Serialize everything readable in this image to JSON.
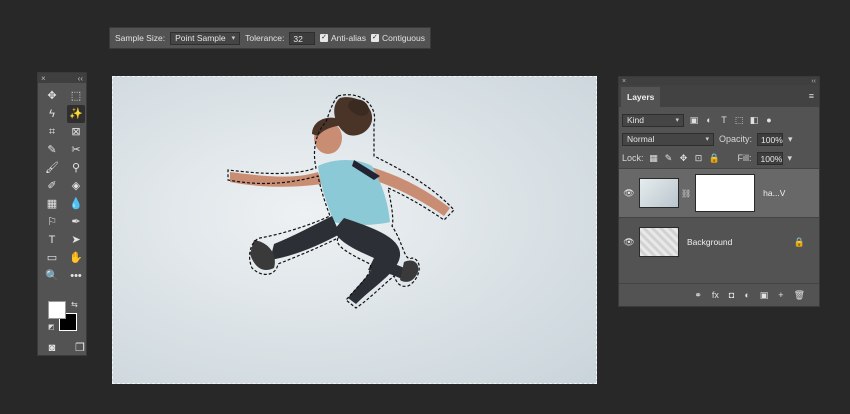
{
  "options_bar": {
    "sample_size_label": "Sample Size:",
    "sample_size_value": "Point Sample",
    "tolerance_label": "Tolerance:",
    "tolerance_value": "32",
    "anti_alias_label": "Anti-alias",
    "anti_alias_checked": true,
    "contiguous_label": "Contiguous",
    "contiguous_checked": true
  },
  "tools": {
    "header_close": "×",
    "header_collapse": "‹‹",
    "items": [
      {
        "glyph": "✥"
      },
      {
        "glyph": "⬚"
      },
      {
        "glyph": "ϟ"
      },
      {
        "glyph": "✨"
      },
      {
        "glyph": "⌗"
      },
      {
        "glyph": "⊠"
      },
      {
        "glyph": "✎"
      },
      {
        "glyph": "✂"
      },
      {
        "glyph": "🖌"
      },
      {
        "glyph": "⚲"
      },
      {
        "glyph": "✐"
      },
      {
        "glyph": "◈"
      },
      {
        "glyph": "▦"
      },
      {
        "glyph": "💧"
      },
      {
        "glyph": "⚐"
      },
      {
        "glyph": "✒"
      },
      {
        "glyph": "T"
      },
      {
        "glyph": "➤"
      },
      {
        "glyph": "▭"
      },
      {
        "glyph": "✋"
      },
      {
        "glyph": "🔍"
      },
      {
        "glyph": "•••"
      }
    ],
    "swap_glyph": "⇆",
    "default_glyph": "◩",
    "quickmask_glyph": "◙",
    "screenmode_glyph": "❐"
  },
  "layers": {
    "tab_label": "Layers",
    "header_close": "×",
    "header_collapse": "‹‹",
    "menu_glyph": "≡",
    "filter_value": "Kind",
    "blend_mode": "Normal",
    "opacity_label": "Opacity:",
    "opacity_value": "100%",
    "lock_label": "Lock:",
    "fill_label": "Fill:",
    "fill_value": "100%",
    "items": [
      {
        "name": "ha...V",
        "selected": true,
        "has_mask": true
      },
      {
        "name": "Background",
        "selected": false,
        "locked": true
      }
    ],
    "footer_icons": [
      "⚭",
      "fx",
      "◘",
      "◐",
      "▣",
      "+",
      "🗑"
    ]
  }
}
